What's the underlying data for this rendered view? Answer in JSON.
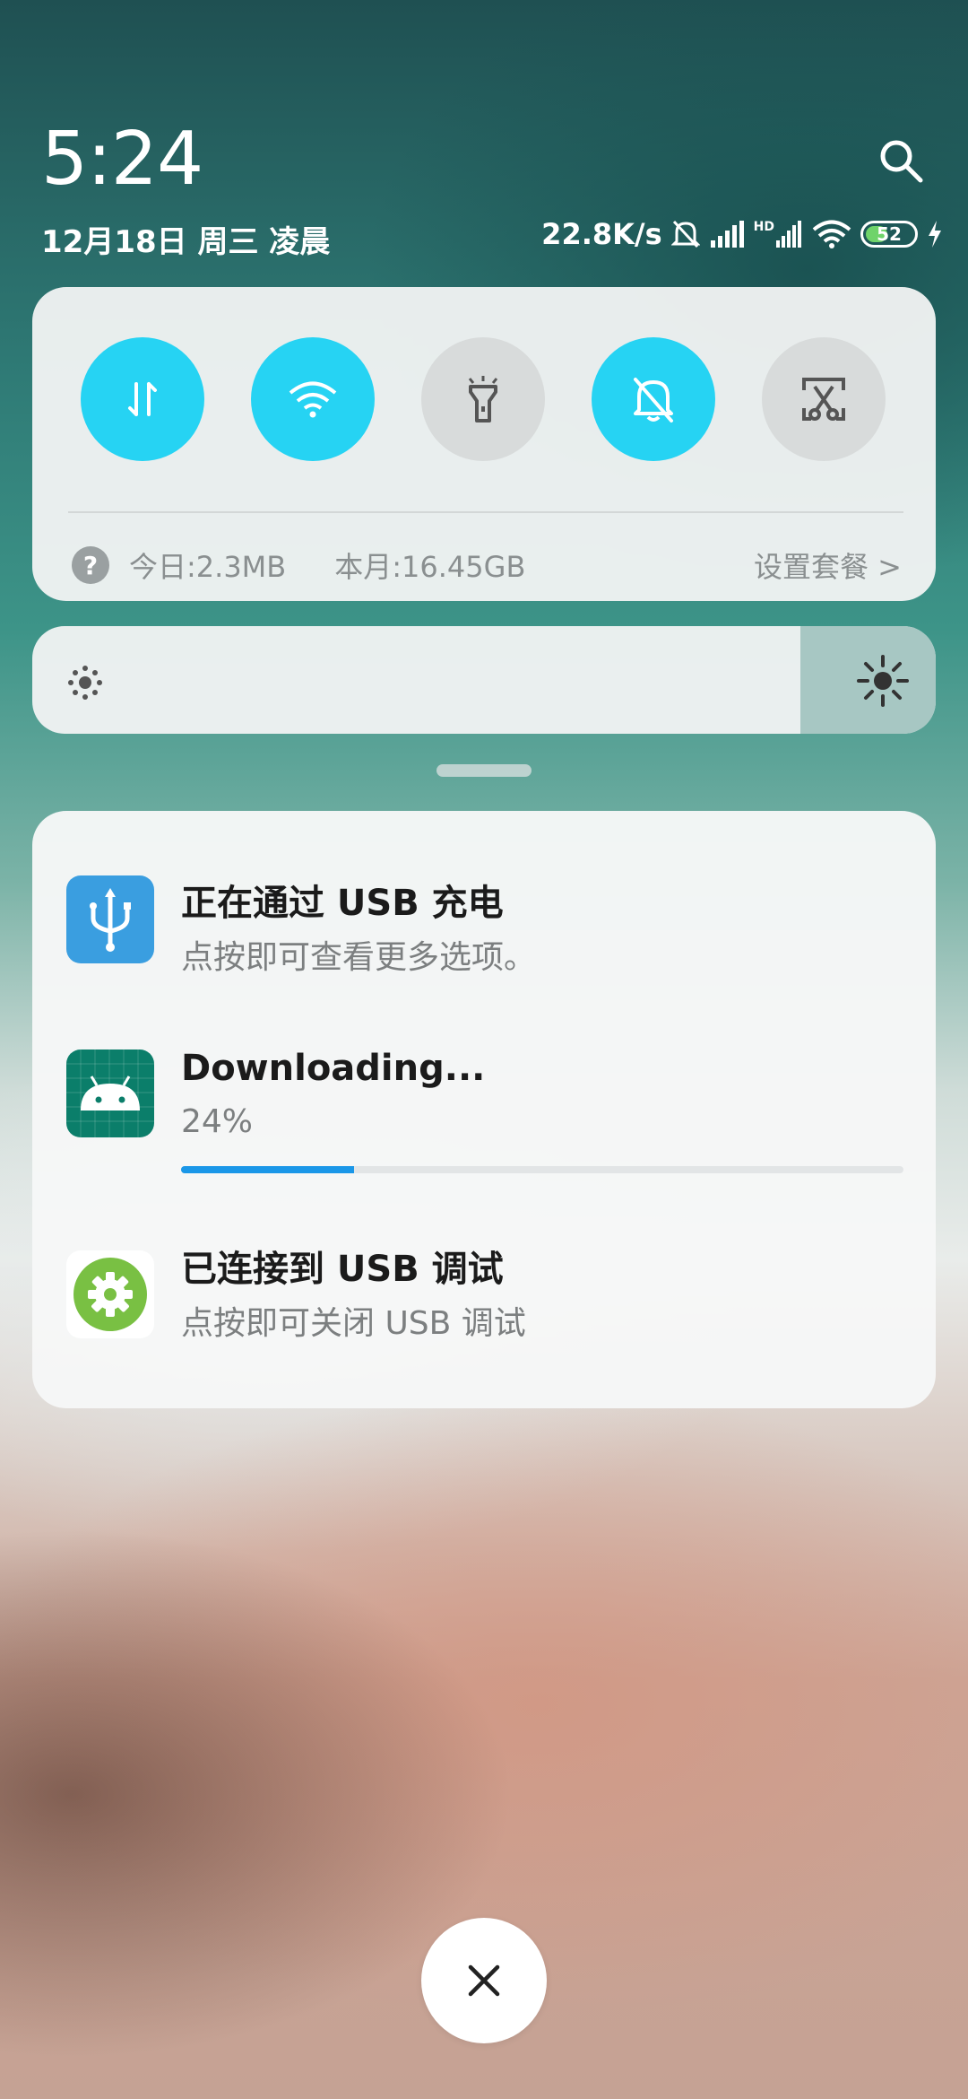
{
  "header": {
    "time": "5:24",
    "date": "12月18日 周三 凌晨"
  },
  "status_bar": {
    "net_speed": "22.8K/s",
    "hd_label": "HD",
    "battery_level": "52",
    "battery_fraction": 0.52,
    "battery_color": "#6fd36a",
    "icons": [
      "bell-off-icon",
      "signal-icon",
      "hd-signal-icon",
      "wifi-icon",
      "battery-icon",
      "charging-bolt-icon"
    ]
  },
  "quick_toggles": [
    {
      "name": "mobile-data",
      "icon": "data-arrows-icon",
      "state": "on"
    },
    {
      "name": "wifi",
      "icon": "wifi-icon",
      "state": "on"
    },
    {
      "name": "flashlight",
      "icon": "flashlight-icon",
      "state": "off"
    },
    {
      "name": "mute",
      "icon": "bell-off-icon",
      "state": "on"
    },
    {
      "name": "screenshot",
      "icon": "scissors-icon",
      "state": "off"
    }
  ],
  "data_usage": {
    "help": "?",
    "today": "今日:2.3MB",
    "month": "本月:16.45GB",
    "plan_link": "设置套餐 >"
  },
  "brightness": {
    "level": 0.85
  },
  "notifications": [
    {
      "title": "正在通过 USB 充电",
      "subtitle": "点按即可查看更多选项。",
      "icon": "usb-icon"
    },
    {
      "title": "Downloading...",
      "subtitle": "24%",
      "progress": 0.24,
      "icon": "android-icon"
    },
    {
      "title": "已连接到 USB 调试",
      "subtitle": "点按即可关闭 USB 调试",
      "icon": "gear-icon"
    }
  ],
  "colors": {
    "toggle_on": "#26d3f3",
    "toggle_off": "#d8dbdb",
    "progress": "#1a97e8",
    "usb_icon_bg": "#3a9ee0",
    "android_icon_bg": "#0b7e6a",
    "debug_icon_green": "#79c043"
  }
}
